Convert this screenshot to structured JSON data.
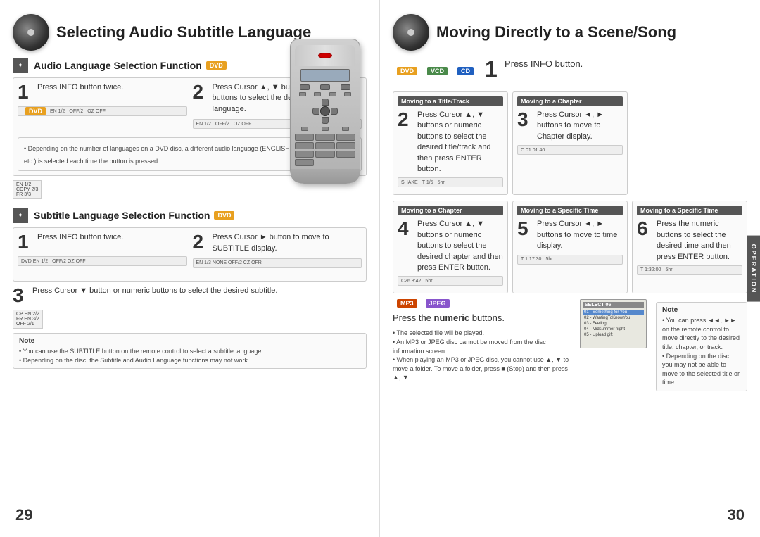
{
  "left_page": {
    "title": "Selecting Audio Subtitle Language",
    "page_number": "29",
    "audio_section": {
      "title": "Audio Language Selection Function",
      "badge": "DVD",
      "step1": {
        "number": "1",
        "text": "Press INFO button twice."
      },
      "step2": {
        "number": "2",
        "text": "Press Cursor ▲, ▼ buttons or numeric buttons to select the desired audio language."
      },
      "note": "• Depending on the number of languages on a DVD disc, a different audio language (ENGLISH, SPAIN, JAPANESE, etc.) is selected each time the button is pressed."
    },
    "subtitle_section": {
      "title": "Subtitle Language Selection Function",
      "badge": "DVD",
      "step1": {
        "number": "1",
        "text": "Press INFO button twice."
      },
      "step2": {
        "number": "2",
        "text": "Press Cursor ► button to move to SUBTITLE display."
      },
      "step3": {
        "number": "3",
        "text": "Press Cursor ▼ button or numeric buttons to select the desired subtitle."
      },
      "note_title": "Note",
      "note_lines": [
        "• You can use the SUBTITLE button on the remote control to select a subtitle language.",
        "• Depending on the disc, the Subtitle and Audio Language functions may not work."
      ]
    }
  },
  "right_page": {
    "title": "Moving Directly to a Scene/Song",
    "page_number": "30",
    "badges": [
      "DVD",
      "VCD",
      "CD"
    ],
    "step1": {
      "number": "1",
      "text": "Press INFO button."
    },
    "moving_title_track": {
      "header": "Moving to a Title/Track",
      "number": "2",
      "text": "Press Cursor ▲, ▼ buttons or numeric buttons to select the desired title/track and then press ENTER button."
    },
    "moving_chapter_right": {
      "header": "Moving to a Chapter",
      "number": "3",
      "text": "Press Cursor ◄, ► buttons to move to Chapter display."
    },
    "moving_chapter_left": {
      "header": "Moving to a Chapter",
      "number": "4",
      "text": "Press Cursor ▲, ▼ buttons or numeric buttons to select the desired chapter and then press ENTER button."
    },
    "moving_specific_time_mid": {
      "header": "Moving to a Specific Time",
      "number": "5",
      "text": "Press Cursor ◄, ► buttons to move to time display."
    },
    "moving_specific_time_right": {
      "header": "Moving to a Specific Time",
      "number": "6",
      "text": "Press the numeric buttons to select the desired time and then press ENTER button."
    },
    "mp3_section": {
      "badges": [
        "MP3",
        "JPEG"
      ],
      "text": "Press the numeric buttons.",
      "text_bold": "numeric",
      "bullet_points": [
        "• The selected file will be played.",
        "• An MP3 or JPEG disc cannot be moved from the disc information screen.",
        "• When playing an MP3 or JPEG disc, you cannot use ▲, ▼  to move a folder. To move a folder, press ■ (Stop) and then press ▲, ▼."
      ]
    },
    "note": {
      "title": "Note",
      "lines": [
        "• You can press ◄◄, ►► on the remote control to move directly to the desired title, chapter, or track.",
        "• Depending on the disc, you may not be able to move to the selected title or time."
      ]
    },
    "operation_label": "OPERATION"
  }
}
